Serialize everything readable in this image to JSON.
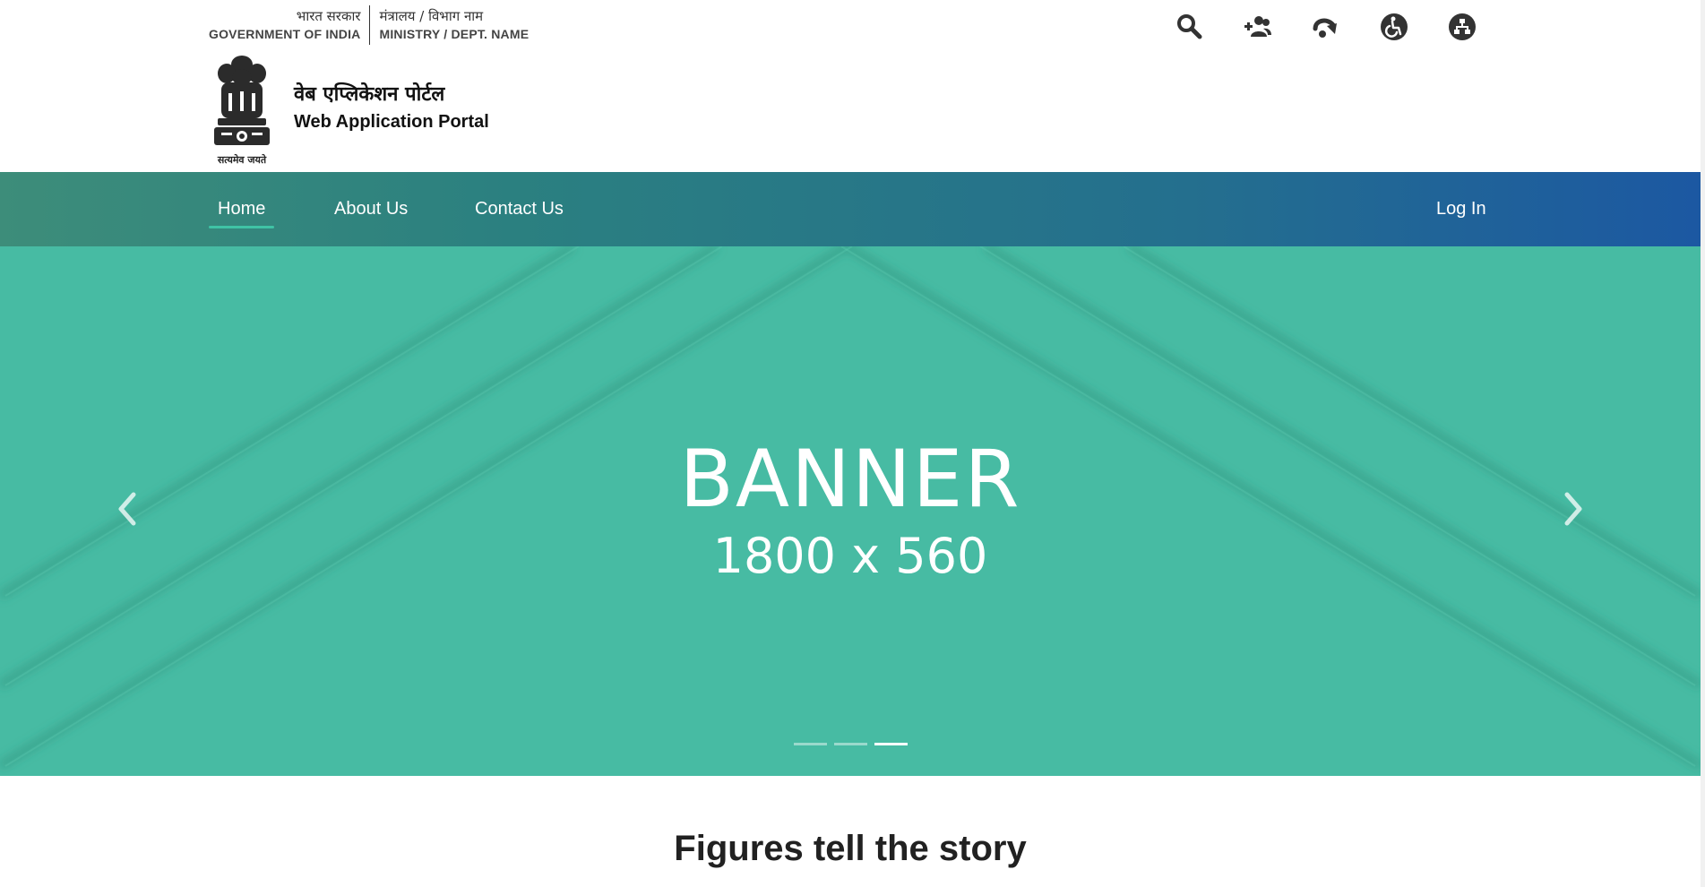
{
  "header": {
    "gov_hindi": "भारत सरकार",
    "gov_english": "GOVERNMENT OF INDIA",
    "ministry_hindi": "मंत्रालय / विभाग नाम",
    "ministry_english": "MINISTRY / DEPT. NAME",
    "emblem_motto": "सत्यमेव जयते",
    "portal_hindi": "वेब एप्लिकेशन पोर्टल",
    "portal_english": "Web Application Portal",
    "utility_icons": [
      "search-icon",
      "social-users-icon",
      "skip-to-content-icon",
      "accessibility-icon",
      "sitemap-icon"
    ]
  },
  "nav": {
    "home": "Home",
    "about": "About Us",
    "contact": "Contact Us",
    "login": "Log In"
  },
  "banner": {
    "title": "BANNER",
    "subtitle": "1800 x 560",
    "slides": 3,
    "active_slide": 3,
    "background_color": "#47bba3"
  },
  "section": {
    "title": "Figures tell the story"
  },
  "colors": {
    "nav_start": "#3d8d7a",
    "nav_end": "#1c58a2",
    "active_underline": "#3fc3a5"
  }
}
